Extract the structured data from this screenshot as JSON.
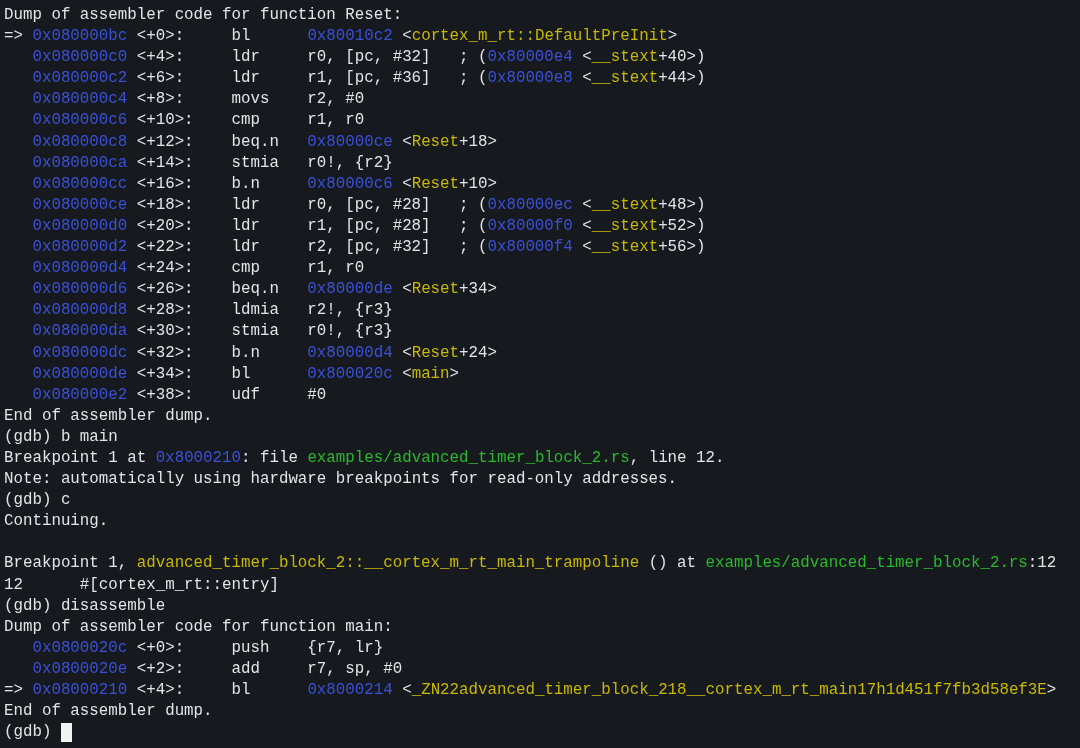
{
  "terminal": {
    "lines": [
      {
        "kind": "text",
        "segments": [
          {
            "kind": "plain",
            "text": "Dump of assembler code for function Reset:"
          }
        ]
      },
      {
        "kind": "text",
        "segments": [
          {
            "kind": "plain",
            "text": "=> "
          },
          {
            "kind": "address",
            "text": "0x080000bc"
          },
          {
            "kind": "plain",
            "text": " <+0>:     bl      "
          },
          {
            "kind": "address",
            "text": "0x80010c2"
          },
          {
            "kind": "plain",
            "text": " <"
          },
          {
            "kind": "symbol",
            "text": "cortex_m_rt::DefaultPreInit"
          },
          {
            "kind": "plain",
            "text": ">"
          }
        ]
      },
      {
        "kind": "code",
        "segments": [
          {
            "kind": "address",
            "text": "0x080000c0"
          },
          {
            "kind": "plain",
            "text": " <+4>:     ldr     r0, [pc, #32]   ; ("
          },
          {
            "kind": "address",
            "text": "0x80000e4"
          },
          {
            "kind": "plain",
            "text": " <"
          },
          {
            "kind": "symbol",
            "text": "__stext"
          },
          {
            "kind": "plain",
            "text": "+40>)"
          }
        ]
      },
      {
        "kind": "code",
        "segments": [
          {
            "kind": "address",
            "text": "0x080000c2"
          },
          {
            "kind": "plain",
            "text": " <+6>:     ldr     r1, [pc, #36]   ; ("
          },
          {
            "kind": "address",
            "text": "0x80000e8"
          },
          {
            "kind": "plain",
            "text": " <"
          },
          {
            "kind": "symbol",
            "text": "__stext"
          },
          {
            "kind": "plain",
            "text": "+44>)"
          }
        ]
      },
      {
        "kind": "code",
        "segments": [
          {
            "kind": "address",
            "text": "0x080000c4"
          },
          {
            "kind": "plain",
            "text": " <+8>:     movs    r2, #0"
          }
        ]
      },
      {
        "kind": "code",
        "segments": [
          {
            "kind": "address",
            "text": "0x080000c6"
          },
          {
            "kind": "plain",
            "text": " <+10>:    cmp     r1, r0"
          }
        ]
      },
      {
        "kind": "code",
        "segments": [
          {
            "kind": "address",
            "text": "0x080000c8"
          },
          {
            "kind": "plain",
            "text": " <+12>:    beq.n   "
          },
          {
            "kind": "address",
            "text": "0x80000ce"
          },
          {
            "kind": "plain",
            "text": " <"
          },
          {
            "kind": "symbol",
            "text": "Reset"
          },
          {
            "kind": "plain",
            "text": "+18>"
          }
        ]
      },
      {
        "kind": "code",
        "segments": [
          {
            "kind": "address",
            "text": "0x080000ca"
          },
          {
            "kind": "plain",
            "text": " <+14>:    stmia   r0!, {r2}"
          }
        ]
      },
      {
        "kind": "code",
        "segments": [
          {
            "kind": "address",
            "text": "0x080000cc"
          },
          {
            "kind": "plain",
            "text": " <+16>:    b.n     "
          },
          {
            "kind": "address",
            "text": "0x80000c6"
          },
          {
            "kind": "plain",
            "text": " <"
          },
          {
            "kind": "symbol",
            "text": "Reset"
          },
          {
            "kind": "plain",
            "text": "+10>"
          }
        ]
      },
      {
        "kind": "code",
        "segments": [
          {
            "kind": "address",
            "text": "0x080000ce"
          },
          {
            "kind": "plain",
            "text": " <+18>:    ldr     r0, [pc, #28]   ; ("
          },
          {
            "kind": "address",
            "text": "0x80000ec"
          },
          {
            "kind": "plain",
            "text": " <"
          },
          {
            "kind": "symbol",
            "text": "__stext"
          },
          {
            "kind": "plain",
            "text": "+48>)"
          }
        ]
      },
      {
        "kind": "code",
        "segments": [
          {
            "kind": "address",
            "text": "0x080000d0"
          },
          {
            "kind": "plain",
            "text": " <+20>:    ldr     r1, [pc, #28]   ; ("
          },
          {
            "kind": "address",
            "text": "0x80000f0"
          },
          {
            "kind": "plain",
            "text": " <"
          },
          {
            "kind": "symbol",
            "text": "__stext"
          },
          {
            "kind": "plain",
            "text": "+52>)"
          }
        ]
      },
      {
        "kind": "code",
        "segments": [
          {
            "kind": "address",
            "text": "0x080000d2"
          },
          {
            "kind": "plain",
            "text": " <+22>:    ldr     r2, [pc, #32]   ; ("
          },
          {
            "kind": "address",
            "text": "0x80000f4"
          },
          {
            "kind": "plain",
            "text": " <"
          },
          {
            "kind": "symbol",
            "text": "__stext"
          },
          {
            "kind": "plain",
            "text": "+56>)"
          }
        ]
      },
      {
        "kind": "code",
        "segments": [
          {
            "kind": "address",
            "text": "0x080000d4"
          },
          {
            "kind": "plain",
            "text": " <+24>:    cmp     r1, r0"
          }
        ]
      },
      {
        "kind": "code",
        "segments": [
          {
            "kind": "address",
            "text": "0x080000d6"
          },
          {
            "kind": "plain",
            "text": " <+26>:    beq.n   "
          },
          {
            "kind": "address",
            "text": "0x80000de"
          },
          {
            "kind": "plain",
            "text": " <"
          },
          {
            "kind": "symbol",
            "text": "Reset"
          },
          {
            "kind": "plain",
            "text": "+34>"
          }
        ]
      },
      {
        "kind": "code",
        "segments": [
          {
            "kind": "address",
            "text": "0x080000d8"
          },
          {
            "kind": "plain",
            "text": " <+28>:    ldmia   r2!, {r3}"
          }
        ]
      },
      {
        "kind": "code",
        "segments": [
          {
            "kind": "address",
            "text": "0x080000da"
          },
          {
            "kind": "plain",
            "text": " <+30>:    stmia   r0!, {r3}"
          }
        ]
      },
      {
        "kind": "code",
        "segments": [
          {
            "kind": "address",
            "text": "0x080000dc"
          },
          {
            "kind": "plain",
            "text": " <+32>:    b.n     "
          },
          {
            "kind": "address",
            "text": "0x80000d4"
          },
          {
            "kind": "plain",
            "text": " <"
          },
          {
            "kind": "symbol",
            "text": "Reset"
          },
          {
            "kind": "plain",
            "text": "+24>"
          }
        ]
      },
      {
        "kind": "code",
        "segments": [
          {
            "kind": "address",
            "text": "0x080000de"
          },
          {
            "kind": "plain",
            "text": " <+34>:    bl      "
          },
          {
            "kind": "address",
            "text": "0x800020c"
          },
          {
            "kind": "plain",
            "text": " <"
          },
          {
            "kind": "symbol",
            "text": "main"
          },
          {
            "kind": "plain",
            "text": ">"
          }
        ]
      },
      {
        "kind": "code",
        "segments": [
          {
            "kind": "address",
            "text": "0x080000e2"
          },
          {
            "kind": "plain",
            "text": " <+38>:    udf     #0"
          }
        ]
      },
      {
        "kind": "text",
        "segments": [
          {
            "kind": "plain",
            "text": "End of assembler dump."
          }
        ]
      },
      {
        "kind": "text",
        "segments": [
          {
            "kind": "plain",
            "text": "(gdb) b main"
          }
        ]
      },
      {
        "kind": "text",
        "segments": [
          {
            "kind": "plain",
            "text": "Breakpoint 1 at "
          },
          {
            "kind": "address",
            "text": "0x8000210"
          },
          {
            "kind": "plain",
            "text": ": file "
          },
          {
            "kind": "path",
            "text": "examples/advanced_timer_block_2.rs"
          },
          {
            "kind": "plain",
            "text": ", line 12."
          }
        ]
      },
      {
        "kind": "text",
        "segments": [
          {
            "kind": "plain",
            "text": "Note: automatically using hardware breakpoints for read-only addresses."
          }
        ]
      },
      {
        "kind": "text",
        "segments": [
          {
            "kind": "plain",
            "text": "(gdb) c"
          }
        ]
      },
      {
        "kind": "text",
        "segments": [
          {
            "kind": "plain",
            "text": "Continuing."
          }
        ]
      },
      {
        "kind": "blank"
      },
      {
        "kind": "text",
        "segments": [
          {
            "kind": "plain",
            "text": "Breakpoint 1, "
          },
          {
            "kind": "symbol",
            "text": "advanced_timer_block_2::__cortex_m_rt_main_trampoline"
          },
          {
            "kind": "plain",
            "text": " () at "
          },
          {
            "kind": "path",
            "text": "examples/advanced_timer_block_2.rs"
          },
          {
            "kind": "plain",
            "text": ":12"
          }
        ]
      },
      {
        "kind": "text",
        "segments": [
          {
            "kind": "plain",
            "text": "12      #[cortex_m_rt::entry]"
          }
        ]
      },
      {
        "kind": "text",
        "segments": [
          {
            "kind": "plain",
            "text": "(gdb) disassemble"
          }
        ]
      },
      {
        "kind": "text",
        "segments": [
          {
            "kind": "plain",
            "text": "Dump of assembler code for function main:"
          }
        ]
      },
      {
        "kind": "code",
        "segments": [
          {
            "kind": "address",
            "text": "0x0800020c"
          },
          {
            "kind": "plain",
            "text": " <+0>:     push    {r7, lr}"
          }
        ]
      },
      {
        "kind": "code",
        "segments": [
          {
            "kind": "address",
            "text": "0x0800020e"
          },
          {
            "kind": "plain",
            "text": " <+2>:     add     r7, sp, #0"
          }
        ]
      },
      {
        "kind": "text",
        "segments": [
          {
            "kind": "plain",
            "text": "=> "
          },
          {
            "kind": "address",
            "text": "0x08000210"
          },
          {
            "kind": "plain",
            "text": " <+4>:     bl      "
          },
          {
            "kind": "address",
            "text": "0x8000214"
          },
          {
            "kind": "plain",
            "text": " <"
          },
          {
            "kind": "symbol",
            "text": "_ZN22advanced_timer_block_218__cortex_m_rt_main17h1d451f7fb3d58ef3E"
          },
          {
            "kind": "plain",
            "text": ">"
          }
        ]
      },
      {
        "kind": "text",
        "segments": [
          {
            "kind": "plain",
            "text": "End of assembler dump."
          }
        ]
      },
      {
        "kind": "text",
        "cursor": true,
        "segments": [
          {
            "kind": "plain",
            "text": "(gdb) "
          }
        ]
      }
    ]
  }
}
